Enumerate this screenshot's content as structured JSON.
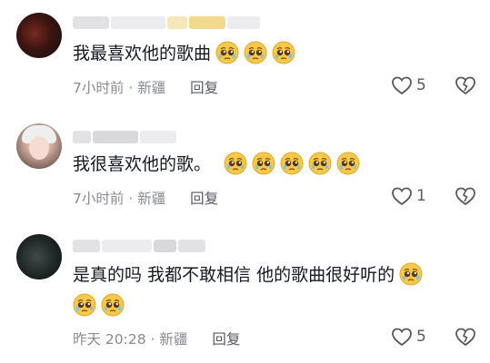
{
  "comments": [
    {
      "text": "我最喜欢他的歌曲",
      "emoji_count": 3,
      "time": "7小时前",
      "location": "新疆",
      "reply_label": "回复",
      "likes": "5"
    },
    {
      "text": "我很喜欢他的歌。",
      "emoji_count": 5,
      "time": "7小时前",
      "location": "新疆",
      "reply_label": "回复",
      "likes": "1"
    },
    {
      "text": "是真的吗 我都不敢相信 他的歌曲很好听的",
      "emoji_count": 3,
      "time": "昨天 20:28",
      "location": "新疆",
      "reply_label": "回复",
      "likes": "5"
    }
  ],
  "separator": "·",
  "emoji_name": "pleading-face-emoji",
  "colors": {
    "meta": "#8a8b91",
    "text": "#161823",
    "emoji_face": "#f7c948"
  }
}
